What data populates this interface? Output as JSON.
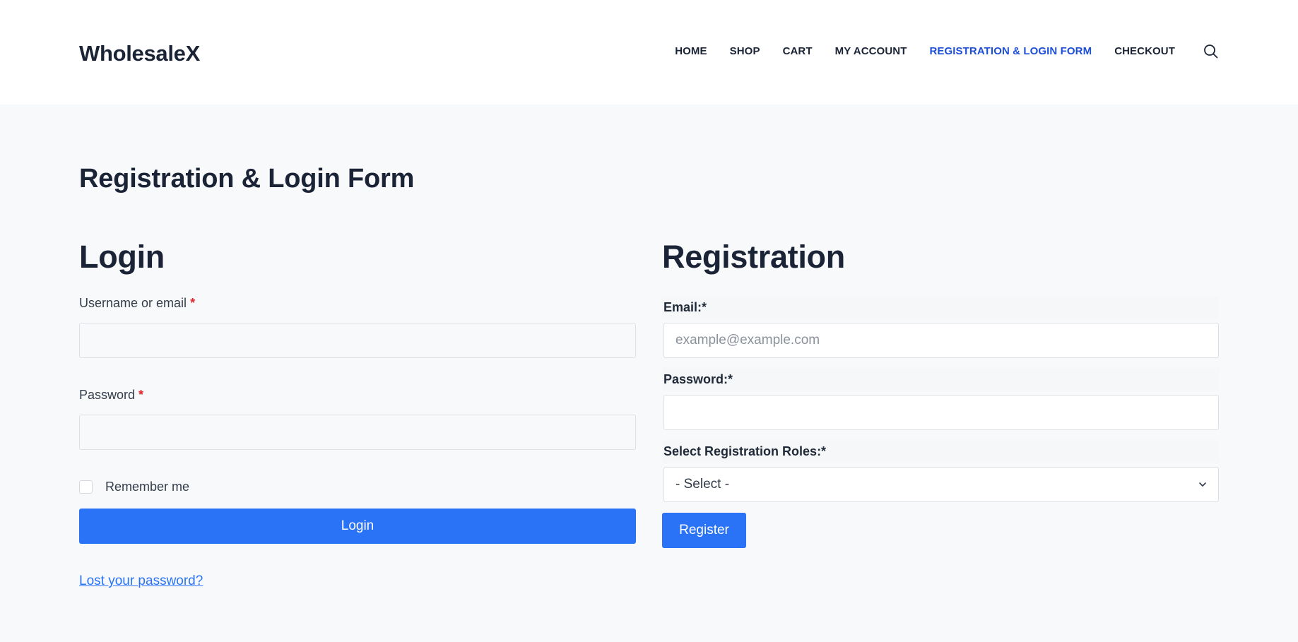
{
  "site": {
    "logo": "WholesaleX"
  },
  "nav": {
    "items": [
      {
        "label": "HOME",
        "active": false
      },
      {
        "label": "SHOP",
        "active": false
      },
      {
        "label": "CART",
        "active": false
      },
      {
        "label": "MY ACCOUNT",
        "active": false
      },
      {
        "label": "REGISTRATION & LOGIN FORM",
        "active": true
      },
      {
        "label": "CHECKOUT",
        "active": false
      }
    ],
    "search_icon": "search-icon"
  },
  "page": {
    "title": "Registration & Login Form"
  },
  "login": {
    "title": "Login",
    "username_label": "Username or email",
    "username_value": "",
    "password_label": "Password",
    "password_value": "",
    "required_mark": "*",
    "remember_label": "Remember me",
    "remember_checked": false,
    "button_label": "Login",
    "lost_password_link": "Lost your password?"
  },
  "registration": {
    "title": "Registration",
    "email_label": "Email:*",
    "email_placeholder": "example@example.com",
    "email_value": "",
    "password_label": "Password:*",
    "password_value": "",
    "roles_label": "Select Registration Roles:*",
    "roles_selected": "- Select -",
    "button_label": "Register"
  },
  "colors": {
    "accent": "#2a73f7",
    "nav_active": "#1d4ed8",
    "heading": "#1a2436",
    "required": "#e0262a",
    "page_bg": "#f8f9fb"
  }
}
